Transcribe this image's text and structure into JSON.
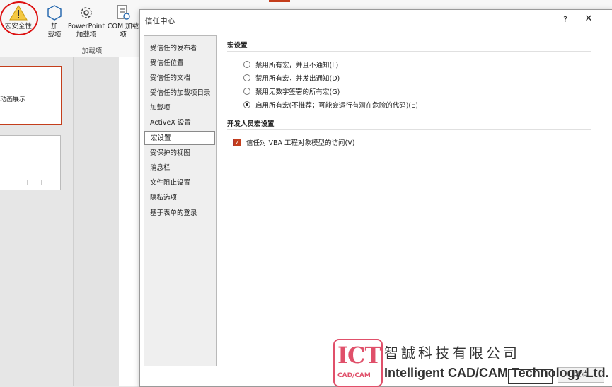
{
  "ribbon": {
    "macro_security_label": "宏安全性",
    "addin_label": "加\n载项",
    "ppt_addin_label": "PowerPoint\n加载项",
    "com_addin_label": "COM 加载项",
    "group_label": "加载项"
  },
  "slides": {
    "thumb1_text": "动画展示"
  },
  "dialog": {
    "title": "信任中心",
    "help": "?",
    "close": "✕",
    "nav": [
      {
        "label": "受信任的发布者"
      },
      {
        "label": "受信任位置"
      },
      {
        "label": "受信任的文档"
      },
      {
        "label": "受信任的加载项目录"
      },
      {
        "label": "加载项"
      },
      {
        "label": "ActiveX 设置"
      },
      {
        "label": "宏设置",
        "selected": true
      },
      {
        "label": "受保护的视图"
      },
      {
        "label": "消息栏"
      },
      {
        "label": "文件阻止设置"
      },
      {
        "label": "隐私选项"
      },
      {
        "label": "基于表单的登录"
      }
    ],
    "macro_section": {
      "title": "宏设置",
      "options": [
        {
          "label": "禁用所有宏，并且不通知(L)",
          "checked": false
        },
        {
          "label": "禁用所有宏，并发出通知(D)",
          "checked": false
        },
        {
          "label": "禁用无数字签署的所有宏(G)",
          "checked": false
        },
        {
          "label": "启用所有宏(不推荐；可能会运行有潜在危险的代码)(E)",
          "checked": true
        }
      ]
    },
    "dev_section": {
      "title": "开发人员宏设置",
      "checkbox_label": "信任对 VBA 工程对象模型的访问(V)",
      "checkbox_checked": true
    },
    "cancel_partial": "取消"
  },
  "watermark": {
    "logo_text": "ICT",
    "logo_sub": "CAD/CAM",
    "company_cn": "智誠科技有限公司",
    "company_en": "Intelligent CAD/CAM Technology Ltd."
  },
  "colors": {
    "accent": "#c43e1c",
    "highlight_circle": "#dd1111",
    "watermark_pink": "#e0506a"
  }
}
